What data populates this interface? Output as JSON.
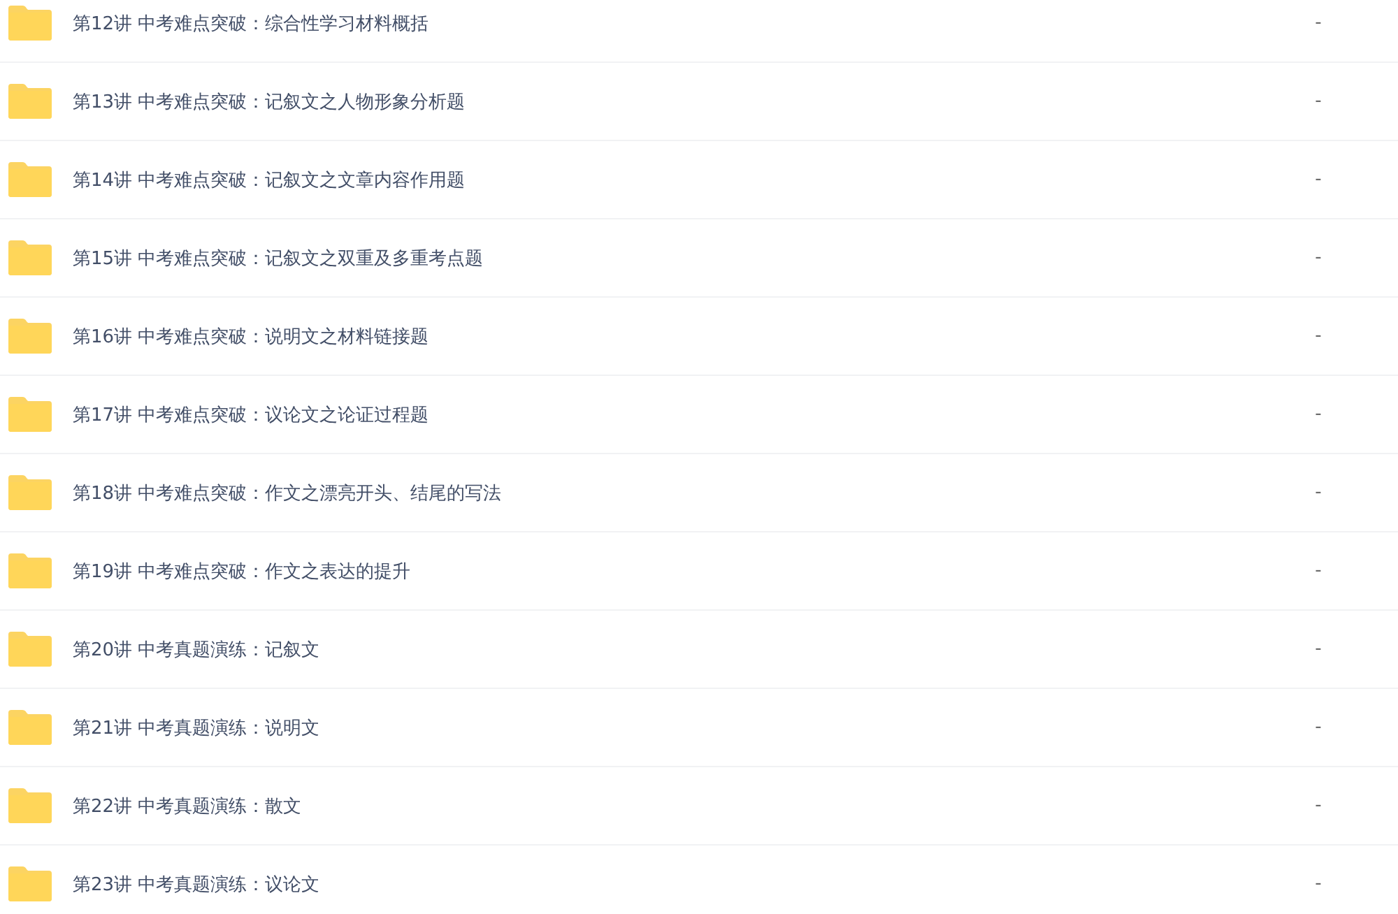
{
  "files": [
    {
      "name": "第12讲 中考难点突破：综合性学习材料概括",
      "size": "-"
    },
    {
      "name": "第13讲 中考难点突破：记叙文之人物形象分析题",
      "size": "-"
    },
    {
      "name": "第14讲 中考难点突破：记叙文之文章内容作用题",
      "size": "-"
    },
    {
      "name": "第15讲 中考难点突破：记叙文之双重及多重考点题",
      "size": "-"
    },
    {
      "name": "第16讲 中考难点突破：说明文之材料链接题",
      "size": "-"
    },
    {
      "name": "第17讲 中考难点突破：议论文之论证过程题",
      "size": "-"
    },
    {
      "name": "第18讲 中考难点突破：作文之漂亮开头、结尾的写法",
      "size": "-"
    },
    {
      "name": "第19讲 中考难点突破：作文之表达的提升",
      "size": "-"
    },
    {
      "name": "第20讲 中考真题演练：记叙文",
      "size": "-"
    },
    {
      "name": "第21讲 中考真题演练：说明文",
      "size": "-"
    },
    {
      "name": "第22讲 中考真题演练：散文",
      "size": "-"
    },
    {
      "name": "第23讲 中考真题演练：议论文",
      "size": "-"
    }
  ]
}
